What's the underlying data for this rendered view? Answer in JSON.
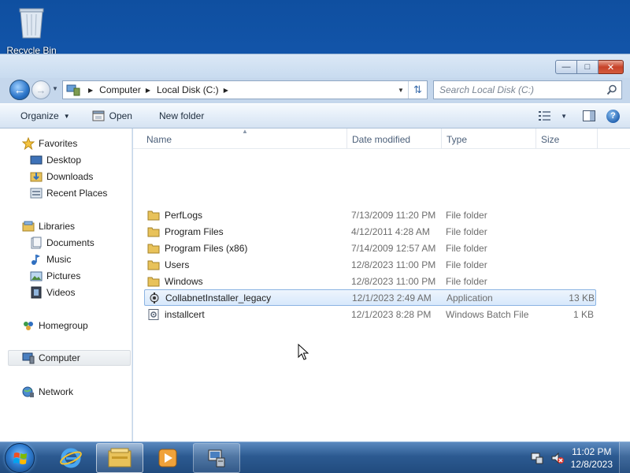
{
  "desktop": {
    "recycle_bin_label": "Recycle Bin"
  },
  "window": {
    "nav": {
      "breadcrumb": [
        "Computer",
        "Local Disk (C:)"
      ],
      "search_placeholder": "Search Local Disk (C:)"
    },
    "commands": {
      "organize": "Organize",
      "open": "Open",
      "new_folder": "New folder"
    },
    "navpane": {
      "favorites": "Favorites",
      "desktop": "Desktop",
      "downloads": "Downloads",
      "recent_places": "Recent Places",
      "libraries": "Libraries",
      "documents": "Documents",
      "music": "Music",
      "pictures": "Pictures",
      "videos": "Videos",
      "homegroup": "Homegroup",
      "computer": "Computer",
      "network": "Network"
    },
    "columns": {
      "name": "Name",
      "date_modified": "Date modified",
      "type": "Type",
      "size": "Size"
    },
    "files": [
      {
        "name": "PerfLogs",
        "date": "7/13/2009 11:20 PM",
        "type": "File folder",
        "size": "",
        "icon": "folder-icon"
      },
      {
        "name": "Program Files",
        "date": "4/12/2011 4:28 AM",
        "type": "File folder",
        "size": "",
        "icon": "folder-icon"
      },
      {
        "name": "Program Files (x86)",
        "date": "7/14/2009 12:57 AM",
        "type": "File folder",
        "size": "",
        "icon": "folder-icon"
      },
      {
        "name": "Users",
        "date": "12/8/2023 11:00 PM",
        "type": "File folder",
        "size": "",
        "icon": "folder-icon"
      },
      {
        "name": "Windows",
        "date": "12/8/2023 11:00 PM",
        "type": "File folder",
        "size": "",
        "icon": "folder-icon"
      },
      {
        "name": "CollabnetInstaller_legacy",
        "date": "12/1/2023 2:49 AM",
        "type": "Application",
        "size": "13 KB",
        "icon": "application-icon"
      },
      {
        "name": "installcert",
        "date": "12/1/2023 8:28 PM",
        "type": "Windows Batch File",
        "size": "1 KB",
        "icon": "batch-file-icon"
      }
    ]
  },
  "taskbar": {
    "clock_time": "11:02 PM",
    "clock_date": "12/8/2023"
  },
  "colors": {
    "selection_border": "#8cb4e3",
    "folder_yellow": "#e8c25a",
    "taskbar_blue": "#2c5a91"
  }
}
